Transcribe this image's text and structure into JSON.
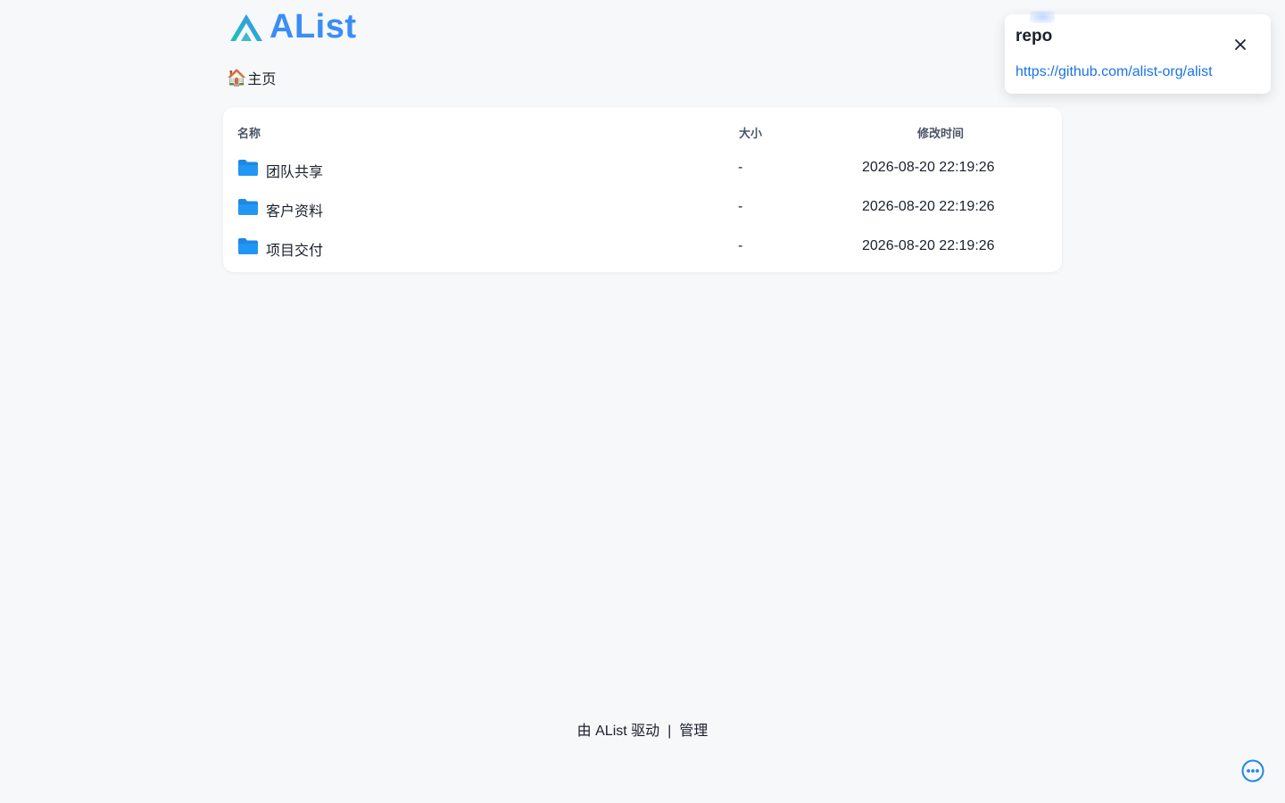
{
  "brand": {
    "name": "AList",
    "accent_color": "#3a8ef6",
    "logo_icon": "alist-logo-icon"
  },
  "breadcrumb": {
    "icon": "🏠",
    "label": "主页"
  },
  "file_list": {
    "headers": {
      "name": "名称",
      "size": "大小",
      "modified": "修改时间"
    },
    "rows": [
      {
        "name": "团队共享",
        "size": "-",
        "modified": "2026-08-20 22:19:26",
        "icon": "folder-icon"
      },
      {
        "name": "客户资料",
        "size": "-",
        "modified": "2026-08-20 22:19:26",
        "icon": "folder-icon"
      },
      {
        "name": "项目交付",
        "size": "-",
        "modified": "2026-08-20 22:19:26",
        "icon": "folder-icon"
      }
    ]
  },
  "footer": {
    "powered_by": "由 AList 驱动",
    "separator": "|",
    "manage": "管理"
  },
  "notification": {
    "title": "repo",
    "link": "https://github.com/alist-org/alist",
    "link_color": "#1a73e8",
    "close_icon": "close-icon"
  },
  "floating": {
    "more_icon": "more-horizontal-icon",
    "color": "#1e88e5"
  }
}
